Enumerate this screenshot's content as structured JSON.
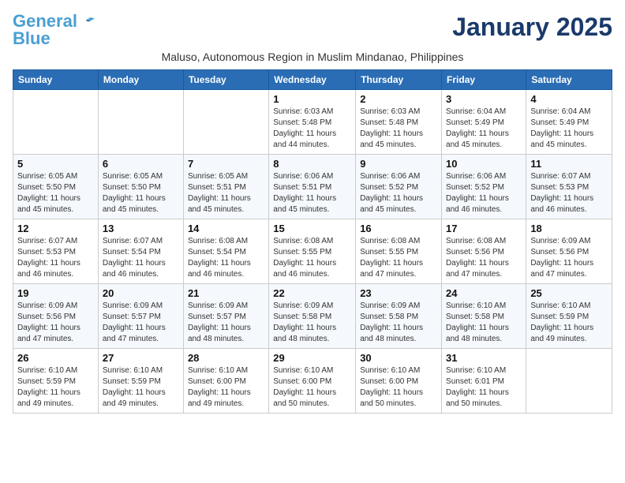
{
  "header": {
    "logo_general": "General",
    "logo_blue": "Blue",
    "month_title": "January 2025",
    "subtitle": "Maluso, Autonomous Region in Muslim Mindanao, Philippines"
  },
  "weekdays": [
    "Sunday",
    "Monday",
    "Tuesday",
    "Wednesday",
    "Thursday",
    "Friday",
    "Saturday"
  ],
  "weeks": [
    [
      {
        "day": "",
        "info": ""
      },
      {
        "day": "",
        "info": ""
      },
      {
        "day": "",
        "info": ""
      },
      {
        "day": "1",
        "info": "Sunrise: 6:03 AM\nSunset: 5:48 PM\nDaylight: 11 hours\nand 44 minutes."
      },
      {
        "day": "2",
        "info": "Sunrise: 6:03 AM\nSunset: 5:48 PM\nDaylight: 11 hours\nand 45 minutes."
      },
      {
        "day": "3",
        "info": "Sunrise: 6:04 AM\nSunset: 5:49 PM\nDaylight: 11 hours\nand 45 minutes."
      },
      {
        "day": "4",
        "info": "Sunrise: 6:04 AM\nSunset: 5:49 PM\nDaylight: 11 hours\nand 45 minutes."
      }
    ],
    [
      {
        "day": "5",
        "info": "Sunrise: 6:05 AM\nSunset: 5:50 PM\nDaylight: 11 hours\nand 45 minutes."
      },
      {
        "day": "6",
        "info": "Sunrise: 6:05 AM\nSunset: 5:50 PM\nDaylight: 11 hours\nand 45 minutes."
      },
      {
        "day": "7",
        "info": "Sunrise: 6:05 AM\nSunset: 5:51 PM\nDaylight: 11 hours\nand 45 minutes."
      },
      {
        "day": "8",
        "info": "Sunrise: 6:06 AM\nSunset: 5:51 PM\nDaylight: 11 hours\nand 45 minutes."
      },
      {
        "day": "9",
        "info": "Sunrise: 6:06 AM\nSunset: 5:52 PM\nDaylight: 11 hours\nand 45 minutes."
      },
      {
        "day": "10",
        "info": "Sunrise: 6:06 AM\nSunset: 5:52 PM\nDaylight: 11 hours\nand 46 minutes."
      },
      {
        "day": "11",
        "info": "Sunrise: 6:07 AM\nSunset: 5:53 PM\nDaylight: 11 hours\nand 46 minutes."
      }
    ],
    [
      {
        "day": "12",
        "info": "Sunrise: 6:07 AM\nSunset: 5:53 PM\nDaylight: 11 hours\nand 46 minutes."
      },
      {
        "day": "13",
        "info": "Sunrise: 6:07 AM\nSunset: 5:54 PM\nDaylight: 11 hours\nand 46 minutes."
      },
      {
        "day": "14",
        "info": "Sunrise: 6:08 AM\nSunset: 5:54 PM\nDaylight: 11 hours\nand 46 minutes."
      },
      {
        "day": "15",
        "info": "Sunrise: 6:08 AM\nSunset: 5:55 PM\nDaylight: 11 hours\nand 46 minutes."
      },
      {
        "day": "16",
        "info": "Sunrise: 6:08 AM\nSunset: 5:55 PM\nDaylight: 11 hours\nand 47 minutes."
      },
      {
        "day": "17",
        "info": "Sunrise: 6:08 AM\nSunset: 5:56 PM\nDaylight: 11 hours\nand 47 minutes."
      },
      {
        "day": "18",
        "info": "Sunrise: 6:09 AM\nSunset: 5:56 PM\nDaylight: 11 hours\nand 47 minutes."
      }
    ],
    [
      {
        "day": "19",
        "info": "Sunrise: 6:09 AM\nSunset: 5:56 PM\nDaylight: 11 hours\nand 47 minutes."
      },
      {
        "day": "20",
        "info": "Sunrise: 6:09 AM\nSunset: 5:57 PM\nDaylight: 11 hours\nand 47 minutes."
      },
      {
        "day": "21",
        "info": "Sunrise: 6:09 AM\nSunset: 5:57 PM\nDaylight: 11 hours\nand 48 minutes."
      },
      {
        "day": "22",
        "info": "Sunrise: 6:09 AM\nSunset: 5:58 PM\nDaylight: 11 hours\nand 48 minutes."
      },
      {
        "day": "23",
        "info": "Sunrise: 6:09 AM\nSunset: 5:58 PM\nDaylight: 11 hours\nand 48 minutes."
      },
      {
        "day": "24",
        "info": "Sunrise: 6:10 AM\nSunset: 5:58 PM\nDaylight: 11 hours\nand 48 minutes."
      },
      {
        "day": "25",
        "info": "Sunrise: 6:10 AM\nSunset: 5:59 PM\nDaylight: 11 hours\nand 49 minutes."
      }
    ],
    [
      {
        "day": "26",
        "info": "Sunrise: 6:10 AM\nSunset: 5:59 PM\nDaylight: 11 hours\nand 49 minutes."
      },
      {
        "day": "27",
        "info": "Sunrise: 6:10 AM\nSunset: 5:59 PM\nDaylight: 11 hours\nand 49 minutes."
      },
      {
        "day": "28",
        "info": "Sunrise: 6:10 AM\nSunset: 6:00 PM\nDaylight: 11 hours\nand 49 minutes."
      },
      {
        "day": "29",
        "info": "Sunrise: 6:10 AM\nSunset: 6:00 PM\nDaylight: 11 hours\nand 50 minutes."
      },
      {
        "day": "30",
        "info": "Sunrise: 6:10 AM\nSunset: 6:00 PM\nDaylight: 11 hours\nand 50 minutes."
      },
      {
        "day": "31",
        "info": "Sunrise: 6:10 AM\nSunset: 6:01 PM\nDaylight: 11 hours\nand 50 minutes."
      },
      {
        "day": "",
        "info": ""
      }
    ]
  ]
}
